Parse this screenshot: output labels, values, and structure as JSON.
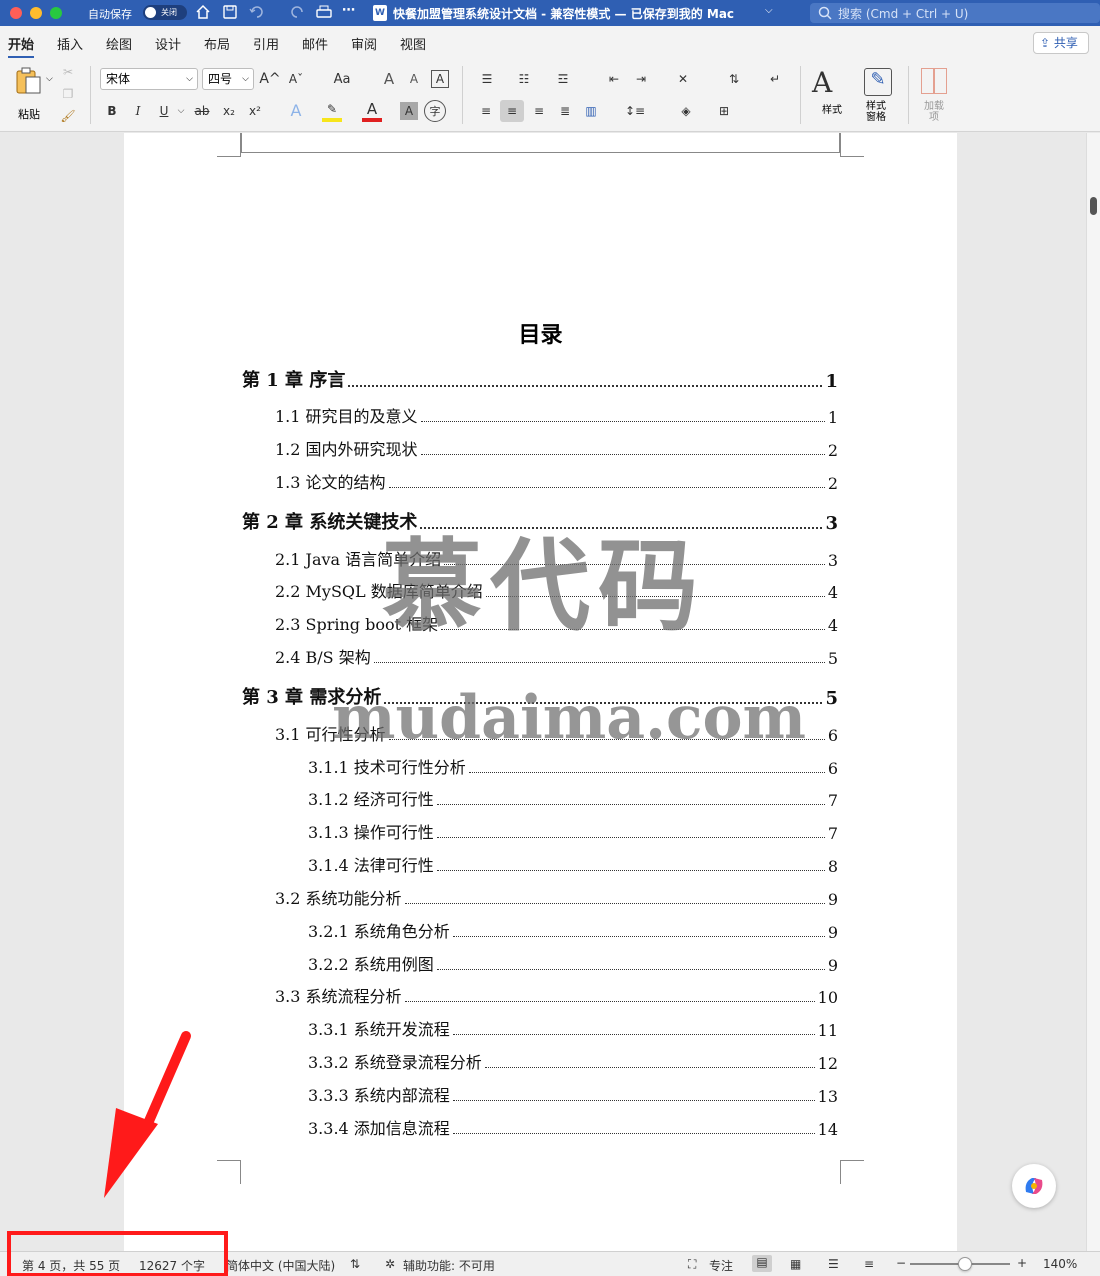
{
  "titlebar": {
    "autosave_label": "自动保存",
    "autosave_state": "关闭",
    "document_title": "快餐加盟管理系统设计文档 - 兼容性模式 — 已保存到我的 Mac",
    "search_placeholder": "搜索 (Cmd + Ctrl + U)",
    "title_icon": "word-doc-icon"
  },
  "tabs": [
    {
      "label": "开始",
      "active": true
    },
    {
      "label": "插入"
    },
    {
      "label": "绘图"
    },
    {
      "label": "设计"
    },
    {
      "label": "布局"
    },
    {
      "label": "引用"
    },
    {
      "label": "邮件"
    },
    {
      "label": "审阅"
    },
    {
      "label": "视图"
    }
  ],
  "share_label": "共享",
  "ribbon": {
    "paste_label": "粘贴",
    "font_name": "宋体",
    "font_size": "四号",
    "styles_label": "样式",
    "styles_pane_label": "样式\n窗格",
    "addins_label": "加载\n项",
    "bold": "B",
    "italic": "I",
    "underline": "U",
    "strike": "ab",
    "subscript": "x₂",
    "superscript": "x²",
    "grow_font": "A^",
    "shrink_font": "Aˇ",
    "change_case": "Aa",
    "char_border": "A",
    "clear_format": "A"
  },
  "document": {
    "toc_title": "目录",
    "entries": [
      {
        "level": 1,
        "text": "第 1 章  序言",
        "page": "1"
      },
      {
        "level": 2,
        "text": "1.1 研究目的及意义",
        "page": "1"
      },
      {
        "level": 2,
        "text": "1.2 国内外研究现状",
        "page": "2"
      },
      {
        "level": 2,
        "text": "1.3 论文的结构",
        "page": "2"
      },
      {
        "level": 1,
        "text": "第 2 章  系统关键技术",
        "page": "3"
      },
      {
        "level": 2,
        "text": "2.1 Java 语言简单介绍",
        "page": "3"
      },
      {
        "level": 2,
        "text": "2.2 MySQL  数据库简单介绍",
        "page": "4"
      },
      {
        "level": 2,
        "text": "2.3 Spring boot 框架",
        "page": "4"
      },
      {
        "level": 2,
        "text": "2.4 B/S 架构",
        "page": "5"
      },
      {
        "level": 1,
        "text": "第 3 章    需求分析",
        "page": "5"
      },
      {
        "level": 2,
        "text": "3.1 可行性分析",
        "page": "6"
      },
      {
        "level": 3,
        "text": "3.1.1 技术可行性分析",
        "page": "6"
      },
      {
        "level": 3,
        "text": "3.1.2 经济可行性",
        "page": "7"
      },
      {
        "level": 3,
        "text": "3.1.3 操作可行性",
        "page": "7"
      },
      {
        "level": 3,
        "text": "3.1.4 法律可行性",
        "page": "8"
      },
      {
        "level": 2,
        "text": "3.2 系统功能分析",
        "page": "9"
      },
      {
        "level": 3,
        "text": "3.2.1 系统角色分析",
        "page": "9"
      },
      {
        "level": 3,
        "text": "3.2.2 系统用例图",
        "page": "9"
      },
      {
        "level": 2,
        "text": "3.3 系统流程分析",
        "page": "10"
      },
      {
        "level": 3,
        "text": "3.3.1 系统开发流程",
        "page": "11"
      },
      {
        "level": 3,
        "text": "3.3.2 系统登录流程分析",
        "page": "12"
      },
      {
        "level": 3,
        "text": "3.3.3 系统内部流程",
        "page": "13"
      },
      {
        "level": 3,
        "text": "3.3.4 添加信息流程",
        "page": "14"
      }
    ]
  },
  "watermark": {
    "line1": "慕代码",
    "line2": "mudaima.com"
  },
  "statusbar": {
    "page_info": "第 4 页，共 55 页",
    "word_count": "12627 个字",
    "language": "简体中文 (中国大陆)",
    "accessibility": "辅助功能: 不可用",
    "focus": "专注",
    "zoom": "140%"
  },
  "colors": {
    "titlebar": "#2f5fb3",
    "annotation": "#ff1a1a"
  }
}
